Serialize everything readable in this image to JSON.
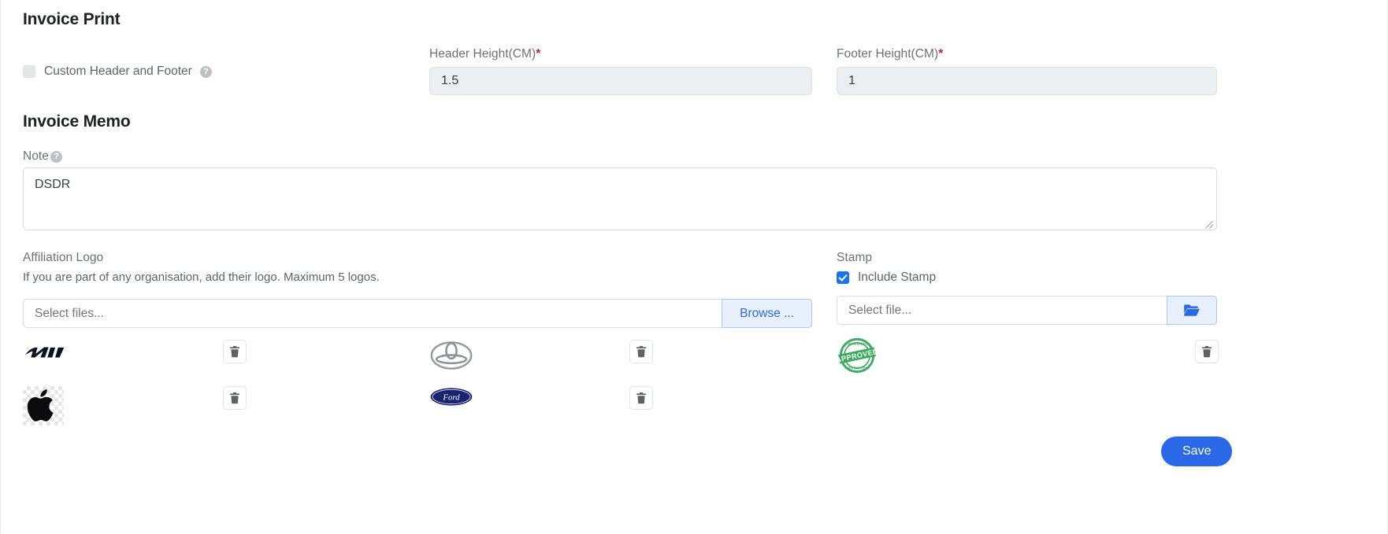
{
  "sections": {
    "invoice_print": "Invoice Print",
    "invoice_memo": "Invoice Memo"
  },
  "invoice_print": {
    "custom_header_footer": {
      "label": "Custom Header and Footer",
      "checked": false,
      "help_icon": "help-circle-icon",
      "help_glyph": "?"
    },
    "header_height": {
      "label": "Header Height(CM)",
      "required_marker": "*",
      "value": "1.5",
      "disabled": true
    },
    "footer_height": {
      "label": "Footer Height(CM)",
      "required_marker": "*",
      "value": "1",
      "disabled": true
    }
  },
  "invoice_memo": {
    "note": {
      "label": "Note",
      "help_icon": "help-circle-icon",
      "help_glyph": "?",
      "value": "DSDR",
      "placeholder": ""
    }
  },
  "affiliation_logo": {
    "label": "Affiliation Logo",
    "hint": "If you are part of any organisation, add their logo. Maximum 5 logos.",
    "file_input_placeholder": "Select files...",
    "file_input_value": "",
    "browse_label": "Browse ...",
    "logos": [
      {
        "name": "kia-logo",
        "alt": "KIA",
        "delete_icon": "trash-icon"
      },
      {
        "name": "toyota-logo",
        "alt": "Toyota",
        "delete_icon": "trash-icon"
      },
      {
        "name": "apple-logo",
        "alt": "Apple",
        "delete_icon": "trash-icon"
      },
      {
        "name": "ford-logo",
        "alt": "Ford",
        "delete_icon": "trash-icon"
      }
    ]
  },
  "stamp": {
    "label": "Stamp",
    "include_stamp_label": "Include Stamp",
    "include_stamp_checked": true,
    "file_input_placeholder": "Select file...",
    "file_input_value": "",
    "browse_icon": "folder-open-icon",
    "stamp_image": {
      "name": "approved-stamp",
      "alt": "APPROVED",
      "delete_icon": "trash-icon"
    }
  },
  "footer": {
    "save_label": "Save"
  },
  "colors": {
    "accent": "#2a68e8",
    "accent_soft_bg": "#e8f0fe",
    "accent_soft_border": "#a8c7fa",
    "required": "#b52b27",
    "label": "#6b7176",
    "heading": "#202124",
    "disabled_field_bg": "#eceff1",
    "stamp_green": "#3aaa5c",
    "ford_blue": "#1a2370"
  }
}
